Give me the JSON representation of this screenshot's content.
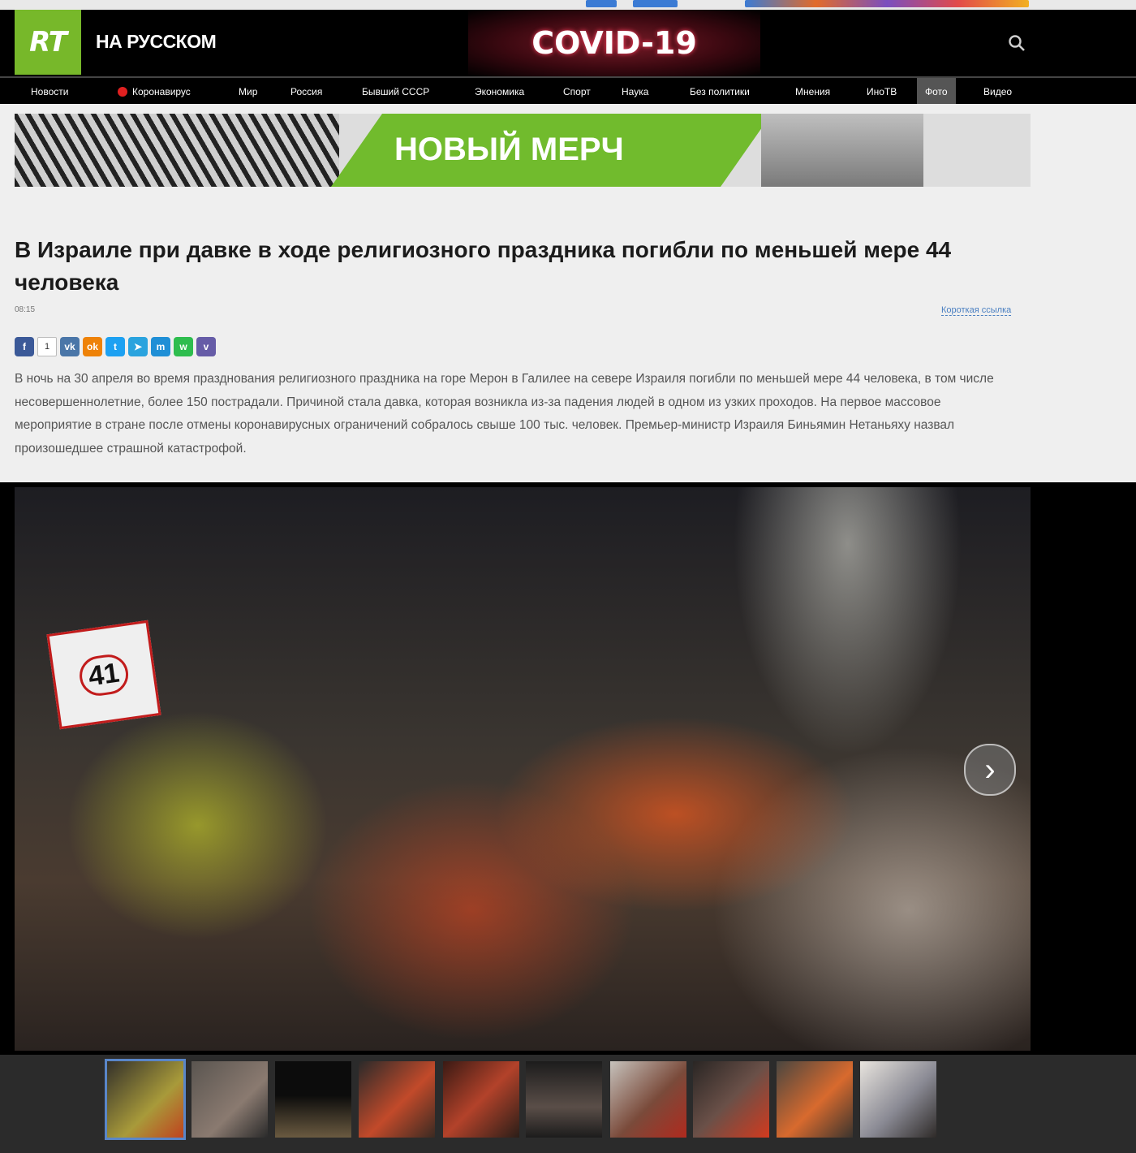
{
  "header": {
    "logo_text": "RT",
    "brand": "НА РУССКОМ",
    "banner": "COVID-19",
    "search_icon": "search-icon"
  },
  "nav": {
    "items": [
      "Новости",
      "Коронавирус",
      "Мир",
      "Россия",
      "Бывший СССР",
      "Экономика",
      "Спорт",
      "Наука",
      "Без политики",
      "Мнения",
      "ИноТВ",
      "Фото",
      "Видео"
    ],
    "active": "Фото"
  },
  "ad": {
    "text": "НОВЫЙ МЕРЧ"
  },
  "article": {
    "title": "В Израиле при давке в ходе религиозного праздника погибли по меньшей мере 44 человека",
    "time": "08:15",
    "short_link": "Короткая ссылка",
    "share_count": "1",
    "lead": "В ночь на 30 апреля во время празднования религиозного праздника на горе Мерон в Галилее на севере Израиля погибли по меньшей мере 44 человека, в том числе несовершеннолетние, более 150 пострадали. Причиной стала давка, которая возникла из-за падения людей в одном из узких проходов. На первое массовое мероприятие в стране после отмены коронавирусных ограничений собралось свыше 100 тыс. человек. Премьер-министр Израиля Биньямин Нетаньяху назвал произошедшее страшной катастрофой."
  },
  "gallery": {
    "sign_number": "41",
    "next_icon": "chevron-right-icon"
  },
  "colors": {
    "accent": "#77b82a",
    "nav_active": "#555555"
  }
}
